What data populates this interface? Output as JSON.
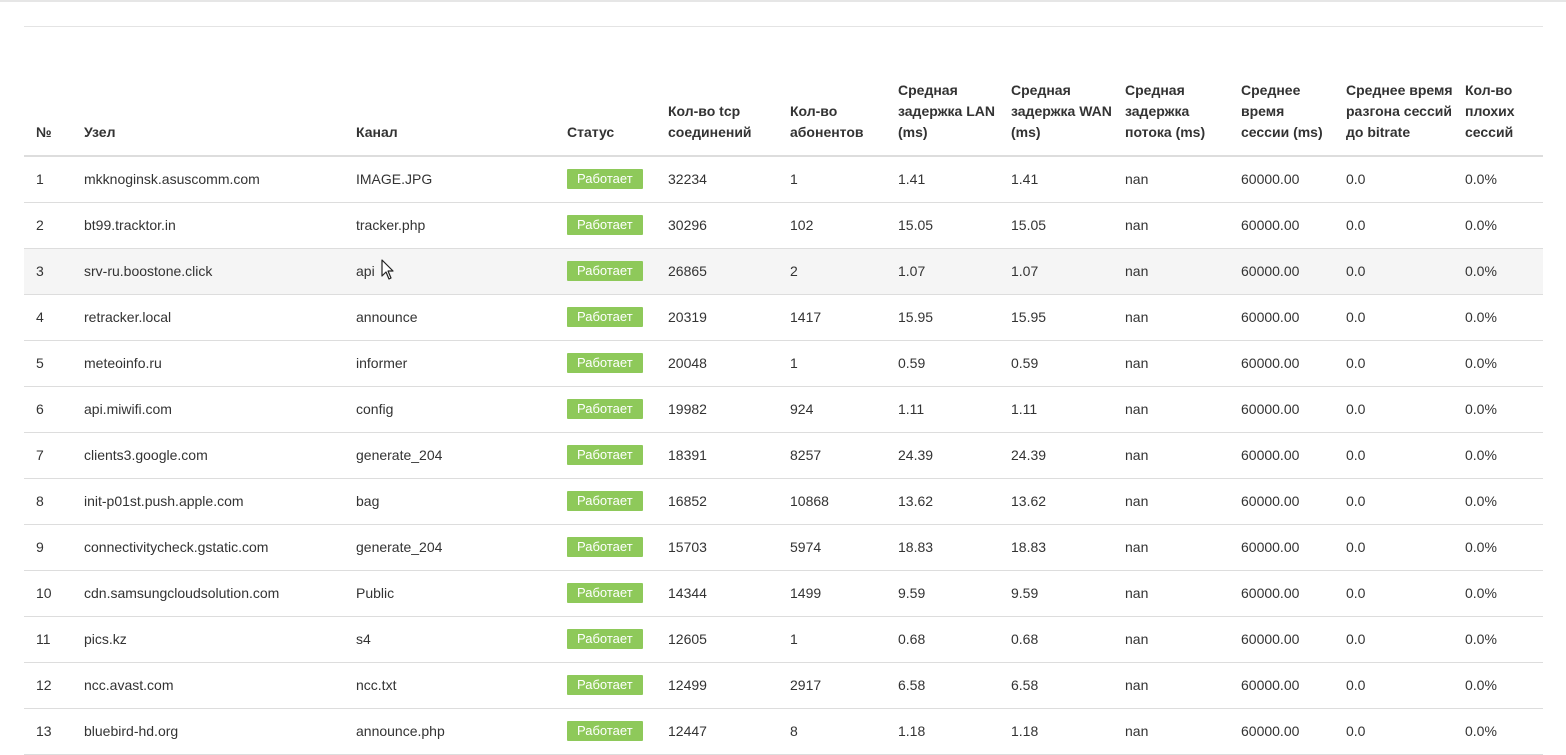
{
  "columns": {
    "num": "№",
    "node": "Узел",
    "channel": "Канал",
    "status": "Статус",
    "tcp": "Кол-во tcp соединений",
    "subscribers": "Кол-во абонентов",
    "lan": "Средная задержка LAN (ms)",
    "wan": "Средная задержка WAN (ms)",
    "flow": "Средная задержка потока (ms)",
    "session": "Среднее время сессии (ms)",
    "ramp": "Среднее время разгона сессий до bitrate",
    "bad": "Кол-во плохих сессий"
  },
  "rows": [
    {
      "num": "1",
      "node": "mkknoginsk.asuscomm.com",
      "channel": "IMAGE.JPG",
      "status": "Работает",
      "tcp": "32234",
      "subscribers": "1",
      "lan": "1.41",
      "wan": "1.41",
      "flow": "nan",
      "session": "60000.00",
      "ramp": "0.0",
      "bad": "0.0%"
    },
    {
      "num": "2",
      "node": "bt99.tracktor.in",
      "channel": "tracker.php",
      "status": "Работает",
      "tcp": "30296",
      "subscribers": "102",
      "lan": "15.05",
      "wan": "15.05",
      "flow": "nan",
      "session": "60000.00",
      "ramp": "0.0",
      "bad": "0.0%"
    },
    {
      "num": "3",
      "node": "srv-ru.boostone.click",
      "channel": "api",
      "status": "Работает",
      "tcp": "26865",
      "subscribers": "2",
      "lan": "1.07",
      "wan": "1.07",
      "flow": "nan",
      "session": "60000.00",
      "ramp": "0.0",
      "bad": "0.0%"
    },
    {
      "num": "4",
      "node": "retracker.local",
      "channel": "announce",
      "status": "Работает",
      "tcp": "20319",
      "subscribers": "1417",
      "lan": "15.95",
      "wan": "15.95",
      "flow": "nan",
      "session": "60000.00",
      "ramp": "0.0",
      "bad": "0.0%"
    },
    {
      "num": "5",
      "node": "meteoinfo.ru",
      "channel": "informer",
      "status": "Работает",
      "tcp": "20048",
      "subscribers": "1",
      "lan": "0.59",
      "wan": "0.59",
      "flow": "nan",
      "session": "60000.00",
      "ramp": "0.0",
      "bad": "0.0%"
    },
    {
      "num": "6",
      "node": "api.miwifi.com",
      "channel": "config",
      "status": "Работает",
      "tcp": "19982",
      "subscribers": "924",
      "lan": "1.11",
      "wan": "1.11",
      "flow": "nan",
      "session": "60000.00",
      "ramp": "0.0",
      "bad": "0.0%"
    },
    {
      "num": "7",
      "node": "clients3.google.com",
      "channel": "generate_204",
      "status": "Работает",
      "tcp": "18391",
      "subscribers": "8257",
      "lan": "24.39",
      "wan": "24.39",
      "flow": "nan",
      "session": "60000.00",
      "ramp": "0.0",
      "bad": "0.0%"
    },
    {
      "num": "8",
      "node": "init-p01st.push.apple.com",
      "channel": "bag",
      "status": "Работает",
      "tcp": "16852",
      "subscribers": "10868",
      "lan": "13.62",
      "wan": "13.62",
      "flow": "nan",
      "session": "60000.00",
      "ramp": "0.0",
      "bad": "0.0%"
    },
    {
      "num": "9",
      "node": "connectivitycheck.gstatic.com",
      "channel": "generate_204",
      "status": "Работает",
      "tcp": "15703",
      "subscribers": "5974",
      "lan": "18.83",
      "wan": "18.83",
      "flow": "nan",
      "session": "60000.00",
      "ramp": "0.0",
      "bad": "0.0%"
    },
    {
      "num": "10",
      "node": "cdn.samsungcloudsolution.com",
      "channel": "Public",
      "status": "Работает",
      "tcp": "14344",
      "subscribers": "1499",
      "lan": "9.59",
      "wan": "9.59",
      "flow": "nan",
      "session": "60000.00",
      "ramp": "0.0",
      "bad": "0.0%"
    },
    {
      "num": "11",
      "node": "pics.kz",
      "channel": "s4",
      "status": "Работает",
      "tcp": "12605",
      "subscribers": "1",
      "lan": "0.68",
      "wan": "0.68",
      "flow": "nan",
      "session": "60000.00",
      "ramp": "0.0",
      "bad": "0.0%"
    },
    {
      "num": "12",
      "node": "ncc.avast.com",
      "channel": "ncc.txt",
      "status": "Работает",
      "tcp": "12499",
      "subscribers": "2917",
      "lan": "6.58",
      "wan": "6.58",
      "flow": "nan",
      "session": "60000.00",
      "ramp": "0.0",
      "bad": "0.0%"
    },
    {
      "num": "13",
      "node": "bluebird-hd.org",
      "channel": "announce.php",
      "status": "Работает",
      "tcp": "12447",
      "subscribers": "8",
      "lan": "1.18",
      "wan": "1.18",
      "flow": "nan",
      "session": "60000.00",
      "ramp": "0.0",
      "bad": "0.0%"
    }
  ],
  "hovered_row": "3",
  "colors": {
    "status_ok": "#8ec95a",
    "hover_row": "#f5f5f5",
    "border": "#dddddd"
  },
  "cursor_icon": "mouse-pointer-icon"
}
